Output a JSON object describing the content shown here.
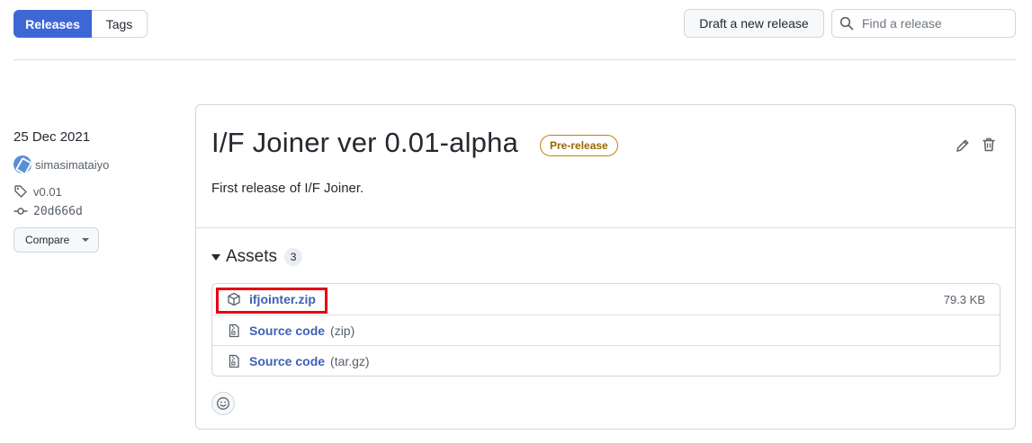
{
  "nav": {
    "releases_label": "Releases",
    "tags_label": "Tags",
    "draft_label": "Draft a new release",
    "search_placeholder": "Find a release"
  },
  "meta": {
    "date": "25 Dec 2021",
    "author": "simasimataiyo",
    "tag": "v0.01",
    "commit": "20d666d",
    "compare_label": "Compare"
  },
  "release": {
    "title": "I/F Joiner ver 0.01-alpha",
    "badge": "Pre-release",
    "body": "First release of I/F Joiner."
  },
  "assets": {
    "label": "Assets",
    "count": "3",
    "items": [
      {
        "name": "ifjointer.zip",
        "ext": "",
        "size": "79.3 KB",
        "icon": "package-icon"
      },
      {
        "name": "Source code",
        "ext": "(zip)",
        "size": "",
        "icon": "file-zip-icon"
      },
      {
        "name": "Source code",
        "ext": "(tar.gz)",
        "size": "",
        "icon": "file-zip-icon"
      }
    ]
  },
  "colors": {
    "accent": "#3e67d6",
    "link": "#3e5fb8",
    "prerelease": "#bf8700",
    "highlight": "#e60012"
  }
}
